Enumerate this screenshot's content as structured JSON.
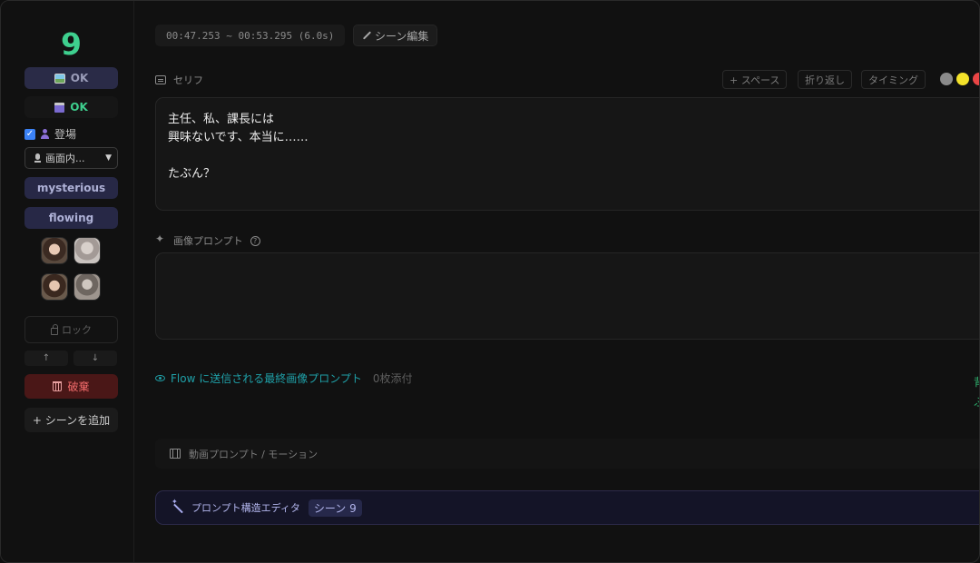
{
  "sidebar": {
    "scene_number": "9",
    "image_status": "OK",
    "video_status": "OK",
    "appear_label": "登場",
    "appear_checked": true,
    "voice_select": "画面内...",
    "mood_tags": [
      "mysterious",
      "flowing"
    ],
    "lock_label": "ロック",
    "move_up": "↑",
    "move_down": "↓",
    "destroy_label": "破棄",
    "add_scene_label": "+ シーンを追加"
  },
  "header": {
    "timecode": "00:47.253 ~ 00:53.295 (6.0s)",
    "edit_scene_label": "シーン編集"
  },
  "dialogue": {
    "label": "セリフ",
    "tools": [
      "+ スペース",
      "折り返し",
      "タイミング"
    ],
    "color_dots": [
      "#8a8a8a",
      "#f3e22a",
      "#e94545"
    ],
    "text": "主任、私、課長には\n興味ないです、本当に……\n\nたぶん？"
  },
  "image_prompt": {
    "label": "画像プロンプト",
    "help": "?",
    "value": ""
  },
  "flow": {
    "link_label": "Flow に送信される最終画像プロンプト",
    "attachments": "0枚添付"
  },
  "edge": {
    "line1": "背",
    "line2": "ふ"
  },
  "video_prompt": {
    "label": "動画プロンプト / モーション"
  },
  "structure_editor": {
    "label": "プロンプト構造エディタ",
    "badge": "シーン 9"
  }
}
